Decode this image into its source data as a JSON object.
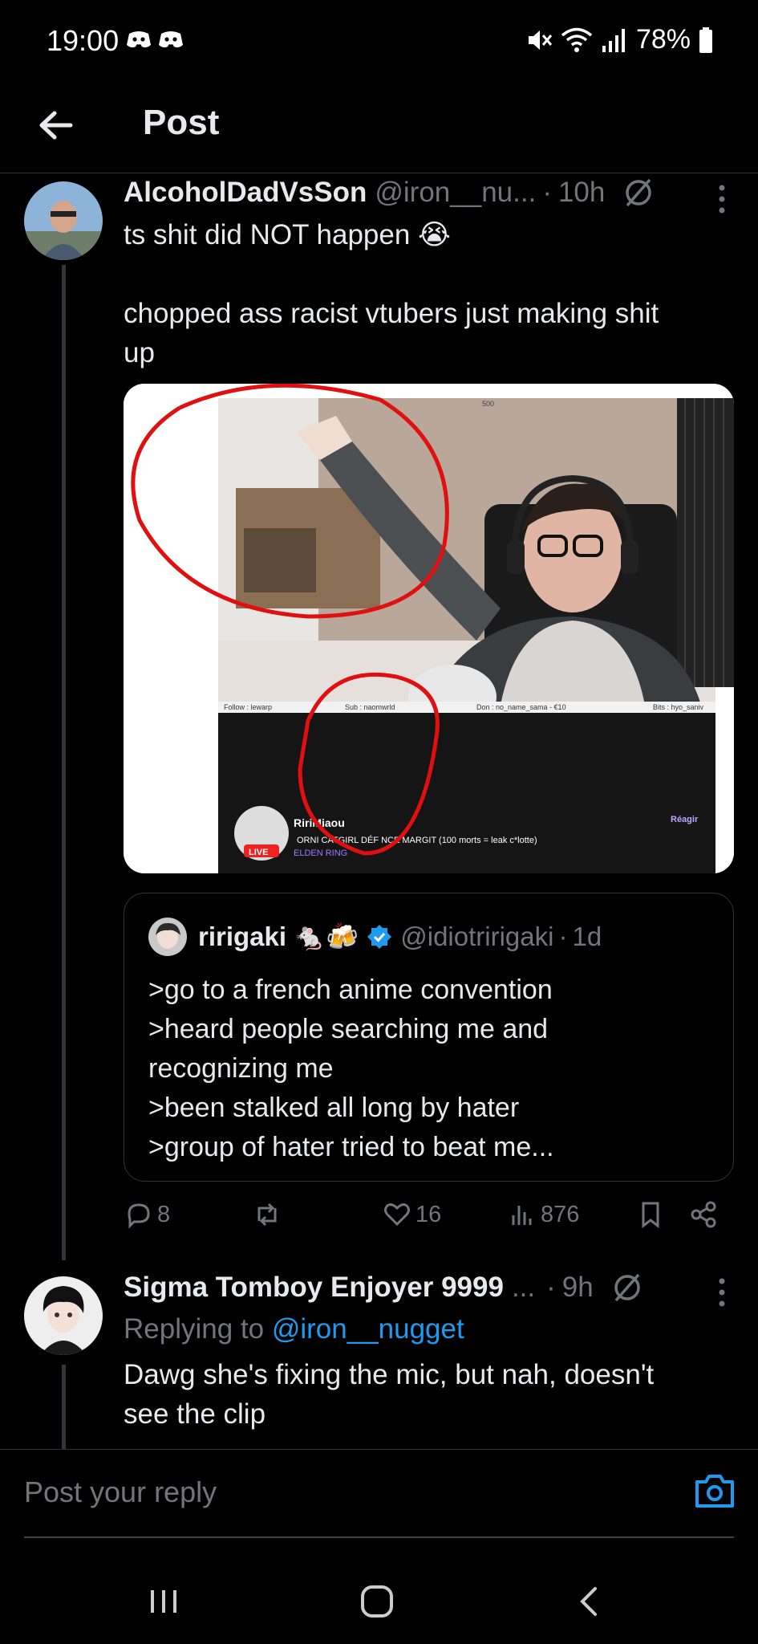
{
  "status": {
    "time": "19:00",
    "battery": "78%"
  },
  "header": {
    "title": "Post"
  },
  "tweet": {
    "name": "AlcoholDadVsSon",
    "handle": "@iron__nu...",
    "time": "10h",
    "line1": "ts shit did NOT happen 😭",
    "line2": "chopped ass racist vtubers just making shit",
    "line3": "up"
  },
  "stream": {
    "streamer": "RiriMiaou",
    "title": "ORNI CATGIRL DÉF NCE MARGIT (100 morts = leak c*lotte)",
    "game": "ELDEN RING",
    "live": "LIVE",
    "react": "Réagir",
    "follow": "Follow : lewarp",
    "sub": "Sub : naomwrld",
    "don": "Don : no_name_sama - €10",
    "bits": "Bits : hyo_saniv",
    "top500": "500"
  },
  "quote": {
    "name": "ririgaki",
    "emoji": "🐁🍻",
    "handle": "@idiotririgaki",
    "time": "1d",
    "lines": [
      ">go to a french anime convention",
      ">heard people searching me and",
      "recognizing me",
      ">been stalked all long by hater",
      ">group of hater tried to beat me..."
    ]
  },
  "actions": {
    "replies": "8",
    "reposts": "",
    "likes": "16",
    "views": "876"
  },
  "reply": {
    "name": "Sigma Tomboy Enjoyer 9999",
    "ellipsis": "...",
    "time": "9h",
    "replying_prefix": "Replying to ",
    "replying_handle": "@iron__nugget",
    "line1": "Dawg she's fixing the mic, but nah,  doesn't",
    "line2": "see the clip"
  },
  "composer": {
    "placeholder": "Post your reply"
  },
  "colors": {
    "accent": "#1d9bf0",
    "muted": "#71767b",
    "bg": "#000000"
  }
}
